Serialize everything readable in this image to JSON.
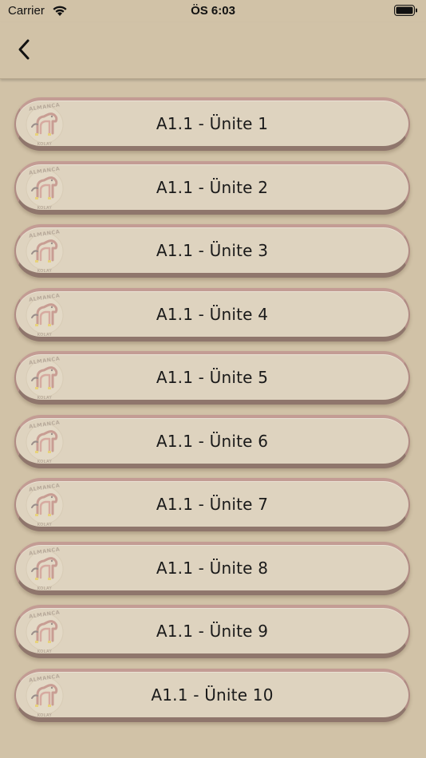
{
  "status_bar": {
    "carrier": "Carrier",
    "time": "ÖS 6:03",
    "battery_level": 1.0
  },
  "nav": {
    "back_icon": "chevron-left-icon"
  },
  "logo": {
    "top_text": "ALMANCA",
    "bottom_text": "KOLAY",
    "icon": "horse-logo-icon"
  },
  "items": [
    {
      "label": "A1.1 - Ünite 1"
    },
    {
      "label": "A1.1 - Ünite 2"
    },
    {
      "label": "A1.1 - Ünite 3"
    },
    {
      "label": "A1.1 - Ünite 4"
    },
    {
      "label": "A1.1 - Ünite 5"
    },
    {
      "label": "A1.1 - Ünite 6"
    },
    {
      "label": "A1.1 - Ünite 7"
    },
    {
      "label": "A1.1 - Ünite 8"
    },
    {
      "label": "A1.1 - Ünite 9"
    },
    {
      "label": "A1.1 - Ünite 10"
    }
  ],
  "colors": {
    "background": "#d1c2a7",
    "item_fill": "#ded3bf",
    "item_border": "#b08c84"
  }
}
